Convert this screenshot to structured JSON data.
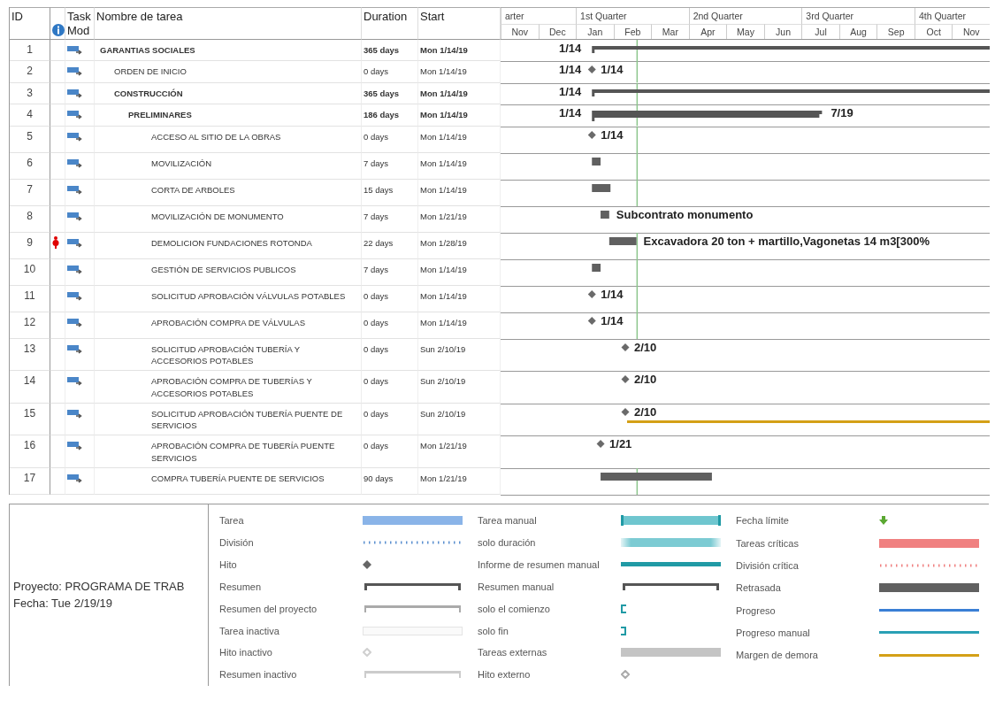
{
  "table": {
    "columns": {
      "id": "ID",
      "mode": "Task Mod",
      "name": "Nombre de tarea",
      "duration": "Duration",
      "start": "Start"
    },
    "rows": [
      {
        "id": "1",
        "name": "GARANTIAS SOCIALES",
        "duration": "365 days",
        "start": "Mon 1/14/19",
        "kind": "summary",
        "overallocated": false,
        "gantt": {
          "left_label": "1/14"
        },
        "children": [
          {
            "id": "2",
            "name": "ORDEN DE INICIO",
            "duration": "0 days",
            "start": "Mon 1/14/19",
            "kind": "milestone",
            "overallocated": false,
            "gantt": {
              "left_label": "1/14",
              "right_label": "1/14"
            }
          },
          {
            "id": "3",
            "name": "CONSTRUCCIÓN",
            "duration": "365 days",
            "start": "Mon 1/14/19",
            "kind": "summary",
            "overallocated": false,
            "gantt": {
              "left_label": "1/14"
            },
            "children": [
              {
                "id": "4",
                "name": "PRELIMINARES",
                "duration": "186 days",
                "start": "Mon 1/14/19",
                "kind": "summary",
                "overallocated": false,
                "gantt": {
                  "left_label": "1/14",
                  "right_label": "7/19"
                },
                "children": [
                  {
                    "id": "5",
                    "name": "ACCESO AL SITIO DE LA OBRAS",
                    "duration": "0 days",
                    "start": "Mon 1/14/19",
                    "kind": "milestone",
                    "overallocated": false,
                    "gantt": {
                      "right_label": "1/14"
                    }
                  },
                  {
                    "id": "6",
                    "name": "MOVILIZACIÓN",
                    "duration": "7 days",
                    "start": "Mon 1/14/19",
                    "kind": "task",
                    "overallocated": false
                  },
                  {
                    "id": "7",
                    "name": "CORTA DE ARBOLES",
                    "duration": "15 days",
                    "start": "Mon 1/14/19",
                    "kind": "task",
                    "overallocated": false
                  },
                  {
                    "id": "8",
                    "name": "MOVILIZACIÓN DE MONUMENTO",
                    "duration": "7 days",
                    "start": "Mon 1/21/19",
                    "kind": "task",
                    "overallocated": false,
                    "gantt": {
                      "right_label": "Subcontrato monumento"
                    }
                  },
                  {
                    "id": "9",
                    "name": "DEMOLICION FUNDACIONES ROTONDA",
                    "duration": "22 days",
                    "start": "Mon 1/28/19",
                    "kind": "task",
                    "overallocated": true,
                    "gantt": {
                      "right_label": "Excavadora 20 ton + martillo,Vagonetas 14 m3[300%"
                    }
                  },
                  {
                    "id": "10",
                    "name": "GESTIÓN DE SERVICIOS PUBLICOS",
                    "duration": "7 days",
                    "start": "Mon 1/14/19",
                    "kind": "task",
                    "overallocated": false
                  },
                  {
                    "id": "11",
                    "name": "SOLICITUD APROBACIÓN VÁLVULAS POTABLES",
                    "duration": "0 days",
                    "start": "Mon 1/14/19",
                    "kind": "milestone",
                    "overallocated": false,
                    "gantt": {
                      "right_label": "1/14"
                    }
                  },
                  {
                    "id": "12",
                    "name": "APROBACIÓN COMPRA DE VÁLVULAS",
                    "duration": "0 days",
                    "start": "Mon 1/14/19",
                    "kind": "milestone",
                    "overallocated": false,
                    "gantt": {
                      "right_label": "1/14"
                    }
                  },
                  {
                    "id": "13",
                    "name": "SOLICITUD APROBACIÓN TUBERÍA Y ACCESORIOS POTABLES",
                    "duration": "0 days",
                    "start": "Sun 2/10/19",
                    "kind": "milestone",
                    "overallocated": false,
                    "gantt": {
                      "right_label": "2/10"
                    }
                  },
                  {
                    "id": "14",
                    "name": "APROBACIÓN COMPRA DE TUBERÍAS Y ACCESORIOS POTABLES",
                    "duration": "0 days",
                    "start": "Sun 2/10/19",
                    "kind": "milestone",
                    "overallocated": false,
                    "gantt": {
                      "right_label": "2/10"
                    }
                  },
                  {
                    "id": "15",
                    "name": "SOLICITUD APROBACIÓN TUBERÍA PUENTE DE SERVICIOS",
                    "duration": "0 days",
                    "start": "Sun 2/10/19",
                    "kind": "milestone",
                    "overallocated": false,
                    "gantt": {
                      "right_label": "2/10",
                      "slack": true
                    }
                  },
                  {
                    "id": "16",
                    "name": "APROBACIÓN COMPRA DE TUBERÍA PUENTE SERVICIOS",
                    "duration": "0 days",
                    "start": "Mon 1/21/19",
                    "kind": "milestone",
                    "overallocated": false,
                    "gantt": {
                      "right_label": "1/21"
                    }
                  },
                  {
                    "id": "17",
                    "name": "COMPRA TUBERÍA PUENTE DE SERVICIOS",
                    "duration": "90 days",
                    "start": "Mon 1/21/19",
                    "kind": "task",
                    "overallocated": false
                  }
                ]
              }
            ]
          }
        ]
      }
    ]
  },
  "timescale": {
    "quarters": [
      "arter",
      "1st Quarter",
      "2nd Quarter",
      "3rd Quarter",
      "4th Quarter"
    ],
    "months": [
      "Nov",
      "Dec",
      "Jan",
      "Feb",
      "Mar",
      "Apr",
      "May",
      "Jun",
      "Jul",
      "Aug",
      "Sep",
      "Oct",
      "Nov"
    ]
  },
  "footer": {
    "project": "Proyecto: PROGRAMA DE TRAB",
    "date": "Fecha: Tue 2/19/19"
  },
  "legend": {
    "columns": [
      [
        {
          "label": "Tarea",
          "kind": "bar",
          "color": "#8ab4e8"
        },
        {
          "label": "División",
          "kind": "dotted",
          "color": "#5b8fd0"
        },
        {
          "label": "Hito",
          "kind": "diamond",
          "color": "#666666"
        },
        {
          "label": "Resumen",
          "kind": "bracket",
          "color": "#555555"
        },
        {
          "label": "Resumen del proyecto",
          "kind": "bracket-thin",
          "color": "#aaaaaa"
        },
        {
          "label": "Tarea inactiva",
          "kind": "outline-bar",
          "color": "#e4e4e4"
        },
        {
          "label": "Hito inactivo",
          "kind": "outline-diamond",
          "color": "#d0d0d0"
        },
        {
          "label": "Resumen inactivo",
          "kind": "bracket-thin",
          "color": "#cccccc"
        }
      ],
      [
        {
          "label": "Tarea manual",
          "kind": "capped-bar",
          "color": "#6fc6cf"
        },
        {
          "label": "solo duración",
          "kind": "fade-bar",
          "color": "#7ccbd3"
        },
        {
          "label": "Informe de resumen manual",
          "kind": "thin-bar",
          "color": "#209aa5"
        },
        {
          "label": "Resumen manual",
          "kind": "bracket",
          "color": "#555555"
        },
        {
          "label": "solo el comienzo",
          "kind": "start-bracket",
          "color": "#209aa5"
        },
        {
          "label": "solo fin",
          "kind": "end-bracket",
          "color": "#209aa5"
        },
        {
          "label": "Tareas externas",
          "kind": "bar",
          "color": "#c4c4c4"
        },
        {
          "label": "Hito externo",
          "kind": "outline-diamond",
          "color": "#aaaaaa"
        }
      ],
      [
        {
          "label": "Fecha límite",
          "kind": "arrow",
          "color": "#5aa832"
        },
        {
          "label": "Tareas críticas",
          "kind": "bar",
          "color": "#f08080"
        },
        {
          "label": "División crítica",
          "kind": "dotted",
          "color": "#f08080"
        },
        {
          "label": "Retrasada",
          "kind": "bar",
          "color": "#606060"
        },
        {
          "label": "Progreso",
          "kind": "line",
          "color": "#3a7fd5"
        },
        {
          "label": "Progreso manual",
          "kind": "line",
          "color": "#2aa0b5"
        },
        {
          "label": "Margen de demora",
          "kind": "line",
          "color": "#d4a017"
        }
      ]
    ]
  }
}
